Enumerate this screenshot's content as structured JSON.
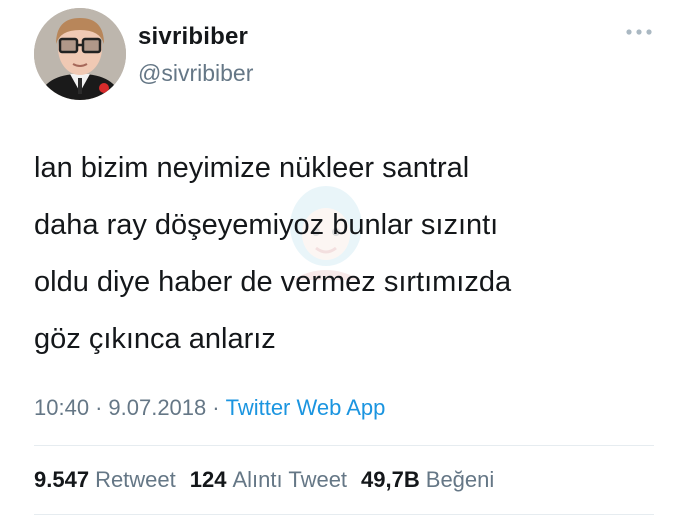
{
  "user": {
    "display_name": "sivribiber",
    "handle": "@sivribiber"
  },
  "tweet": {
    "text": "lan bizim neyimize nükleer santral\ndaha ray döşeyemiyoz bunlar sızıntı\noldu diye haber de vermez sırtımızda\ngöz çıkınca anlarız",
    "time": "10:40",
    "date": "9.07.2018",
    "separator": "·",
    "source": "Twitter Web App"
  },
  "stats": {
    "retweets": {
      "count": "9.547",
      "label": "Retweet"
    },
    "quotes": {
      "count": "124",
      "label": "Alıntı Tweet"
    },
    "likes": {
      "count": "49,7B",
      "label": "Beğeni"
    }
  },
  "colors": {
    "text": "#14171a",
    "secondary": "#657786",
    "link": "#1b95e0",
    "divider": "#e6ecf0"
  },
  "icons": {
    "more": "more-dots-icon",
    "avatar": "profile-avatar"
  }
}
